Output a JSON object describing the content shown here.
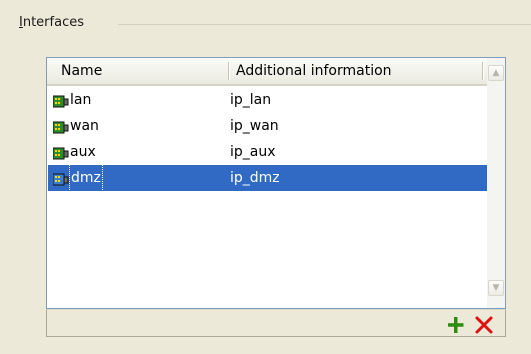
{
  "group": {
    "title_underlined": "I",
    "title_rest": "nterfaces"
  },
  "table": {
    "columns": [
      "Name",
      "Additional information"
    ],
    "rows": [
      {
        "name": "lan",
        "info": "ip_lan",
        "icon": "network-interface-icon",
        "selected": false
      },
      {
        "name": "wan",
        "info": "ip_wan",
        "icon": "network-interface-icon",
        "selected": false
      },
      {
        "name": "aux",
        "info": "ip_aux",
        "icon": "network-interface-icon",
        "selected": false
      },
      {
        "name": "dmz",
        "info": "ip_dmz",
        "icon": "network-interface-icon",
        "selected": true
      }
    ]
  },
  "toolbar": {
    "add_icon": "plus-icon",
    "delete_icon": "delete-x-icon"
  },
  "colors": {
    "selection": "#316AC5",
    "add": "#2E8B12",
    "delete": "#E01010",
    "window": "#ECE9D8"
  }
}
